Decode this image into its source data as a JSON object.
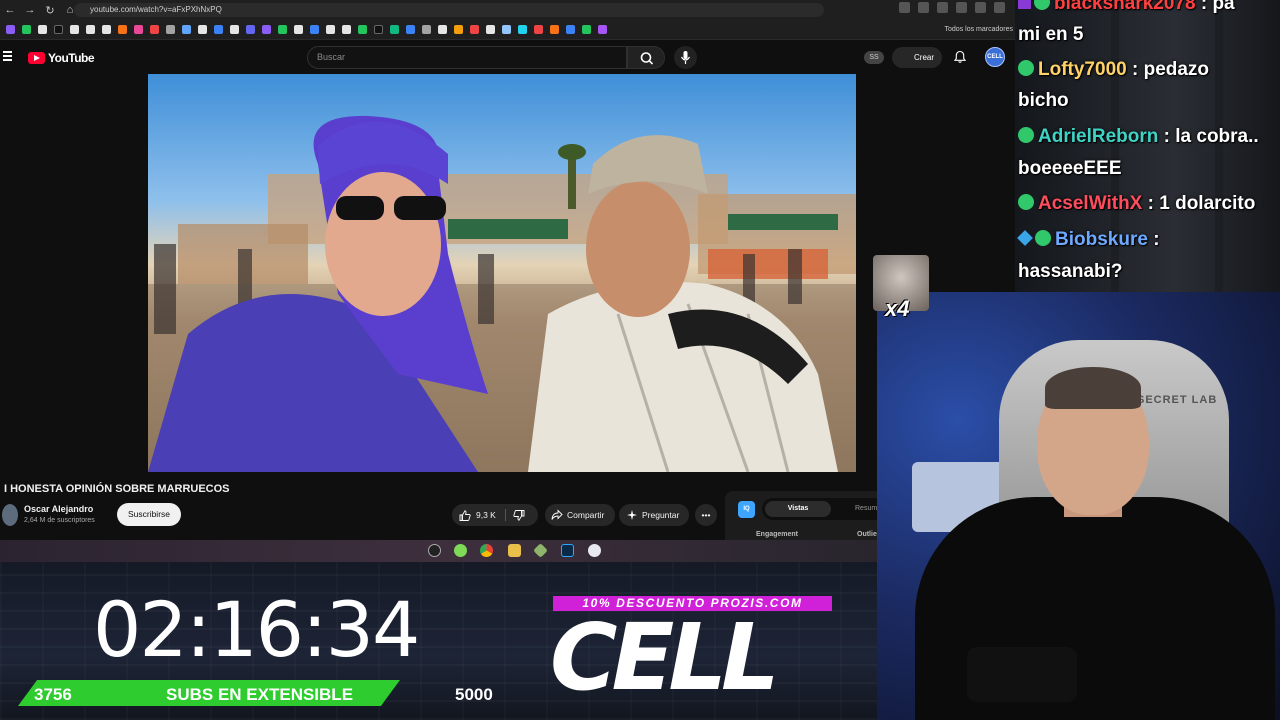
{
  "browser": {
    "url": "youtube.com/watch?v=aFxPXhNxPQ",
    "bookmarks_all": "Todos los marcadores"
  },
  "youtube": {
    "logo_text": "YouTube",
    "search_placeholder": "Buscar",
    "ss_badge": "SS",
    "create_label": "Crear",
    "avatar_text": "CELL"
  },
  "video": {
    "title": "I HONESTA OPINIÓN SOBRE MARRUECOS",
    "channel": "Oscar Alejandro",
    "subscribers": "2,64 M de suscriptores",
    "subscribe_label": "Suscribirse",
    "likes": "9,3 K",
    "share_label": "Compartir",
    "ask_label": "Preguntar",
    "more_label": "•••"
  },
  "side_panel": {
    "logo": "IQ",
    "tab_active": "Vistas",
    "tab_inactive": "Resum",
    "col1": "Engagement",
    "col2": "Outlie"
  },
  "overlay": {
    "timer": "02:16:34",
    "subs_current": "3756",
    "subs_label": "SUBS EN EXTENSIBLE",
    "subs_goal": "5000",
    "subs_progress": 0.7512,
    "promo": "10% DESCUENTO PROZIS.COM",
    "cell_logo": "CELL"
  },
  "chat": {
    "messages": [
      {
        "user": "blackshark2078",
        "text": ": pa",
        "user_color": "#ff4040"
      },
      {
        "user": "",
        "text": "mi en 5",
        "user_color": "#ffffff"
      },
      {
        "user": "Lofty7000",
        "text": ": pedazo",
        "user_color": "#ffd166"
      },
      {
        "user": "",
        "text": "bicho",
        "user_color": "#ffffff"
      },
      {
        "user": "AdrielReborn",
        "text": ": la cobra..",
        "user_color": "#3fd3c6"
      },
      {
        "user": "",
        "text": "boeeeeEEE",
        "user_color": "#ffffff"
      },
      {
        "user": "AcselWithX",
        "text": ": 1 dolarcito",
        "user_color": "#ff4d5e"
      },
      {
        "user": "Biobskure",
        "text": ":",
        "user_color": "#6ea8ff"
      },
      {
        "user": "",
        "text": "hassanabi?",
        "user_color": "#ffffff"
      }
    ]
  },
  "webcam": {
    "chair_brand": "SECRET LAB",
    "emote_text": "x4"
  },
  "colors": {
    "yt_red": "#ff0033",
    "subs_bar": "#2ecc2e",
    "promo_bg": "#d020d8",
    "badge_green": "#30c86a"
  }
}
